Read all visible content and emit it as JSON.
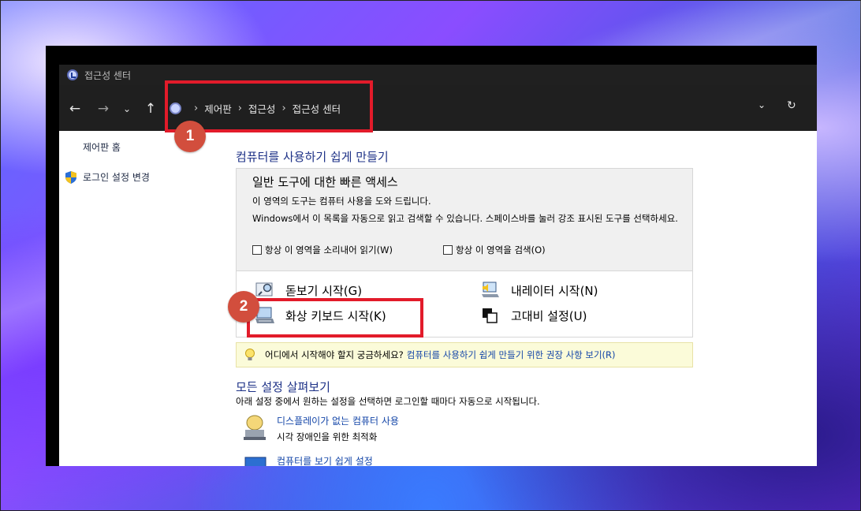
{
  "window": {
    "title": "접근성 센터"
  },
  "nav": {
    "breadcrumb": [
      "제어판",
      "접근성",
      "접근성 센터"
    ]
  },
  "sidebar": {
    "home_label": "제어판 홈",
    "login_label": "로그인 설정 변경"
  },
  "main": {
    "heading": "컴퓨터를 사용하기 쉽게 만들기",
    "quick_access": {
      "title": "일반 도구에 대한 빠른 액세스",
      "desc": "이 영역의 도구는 컴퓨터 사용을 도와 드립니다.",
      "desc2": "Windows에서 이 목록을 자동으로 읽고 검색할 수 있습니다. 스페이스바를 눌러 강조 표시된 도구를 선택하세요.",
      "check_read": "항상 이 영역을 소리내어 읽기(W)",
      "check_scan": "항상 이 영역을 검색(O)",
      "tools": {
        "magnifier": "돋보기 시작(G)",
        "narrator": "내레이터 시작(N)",
        "osk": "화상 키보드 시작(K)",
        "contrast": "고대비 설정(U)"
      }
    },
    "tip": {
      "question": "어디에서 시작해야 할지 궁금하세요?",
      "link": "컴퓨터를 사용하기 쉽게 만들기 위한 권장 사항 보기(R)"
    },
    "all_settings": {
      "heading": "모든 설정 살펴보기",
      "desc": "아래 설정 중에서 원하는 설정을 선택하면 로그인할 때마다 자동으로 시작됩니다.",
      "items": [
        {
          "title": "디스플레이가 없는 컴퓨터 사용",
          "desc": "시각 장애인을 위한 최적화"
        },
        {
          "title": "컴퓨터를 보기 쉽게 설정",
          "desc": ""
        }
      ]
    }
  },
  "annotations": {
    "badge1": "1",
    "badge2": "2",
    "callout_color": "#e21b2a",
    "badge_color": "#d24e3d"
  }
}
